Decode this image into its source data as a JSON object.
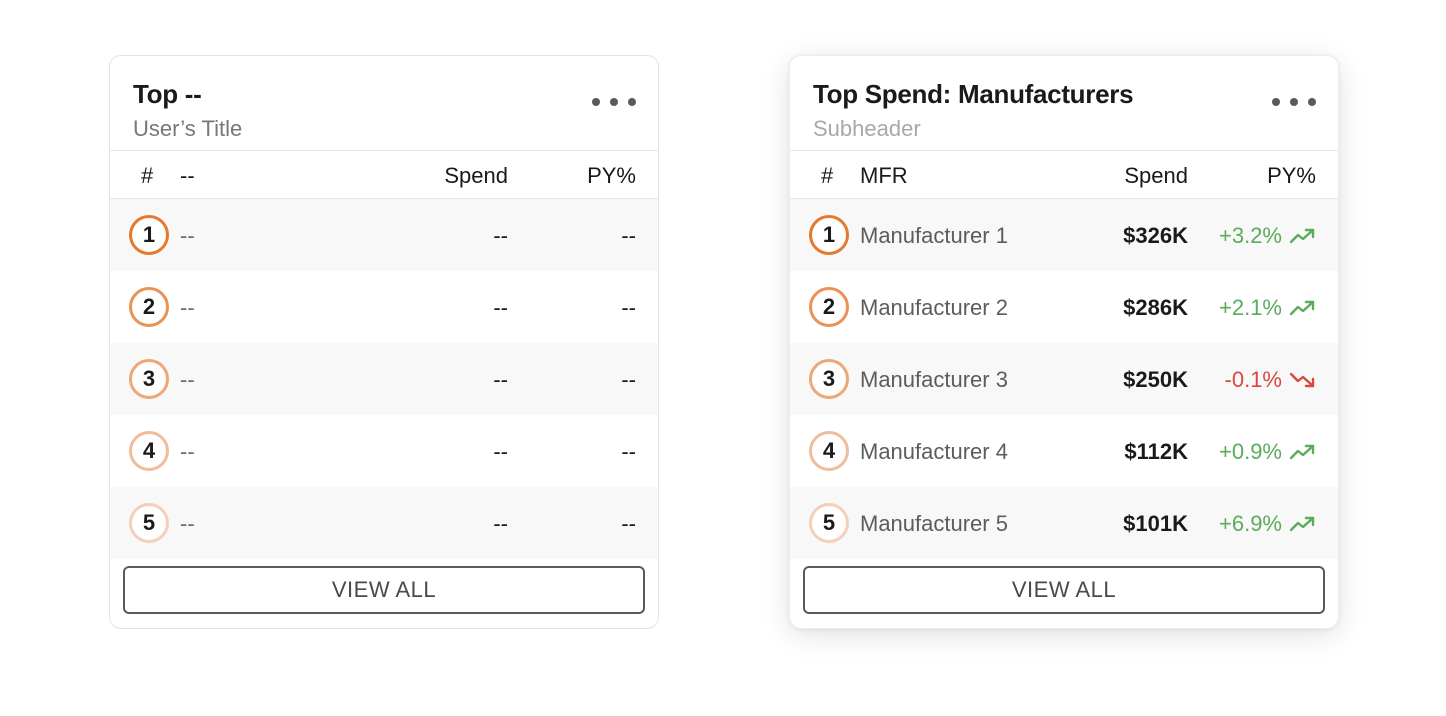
{
  "cards": [
    {
      "title": "Top --",
      "subtitle": "User’s Title",
      "columns": {
        "num": "#",
        "name": "--",
        "spend": "Spend",
        "py": "PY%"
      },
      "rows": [
        {
          "rank": "1",
          "name": "--",
          "spend": "--",
          "py": "--"
        },
        {
          "rank": "2",
          "name": "--",
          "spend": "--",
          "py": "--"
        },
        {
          "rank": "3",
          "name": "--",
          "spend": "--",
          "py": "--"
        },
        {
          "rank": "4",
          "name": "--",
          "spend": "--",
          "py": "--"
        },
        {
          "rank": "5",
          "name": "--",
          "spend": "--",
          "py": "--"
        }
      ],
      "view_all": "VIEW ALL"
    },
    {
      "title": "Top Spend: Manufacturers",
      "subtitle": "Subheader",
      "columns": {
        "num": "#",
        "name": "MFR",
        "spend": "Spend",
        "py": "PY%"
      },
      "rows": [
        {
          "rank": "1",
          "name": "Manufacturer 1",
          "spend": "$326K",
          "py": "+3.2%",
          "trend": "up",
          "trend_icon": "trending-up-icon"
        },
        {
          "rank": "2",
          "name": "Manufacturer 2",
          "spend": "$286K",
          "py": "+2.1%",
          "trend": "up",
          "trend_icon": "trending-up-icon"
        },
        {
          "rank": "3",
          "name": "Manufacturer 3",
          "spend": "$250K",
          "py": "-0.1%",
          "trend": "down",
          "trend_icon": "trending-down-icon"
        },
        {
          "rank": "4",
          "name": "Manufacturer 4",
          "spend": "$112K",
          "py": "+0.9%",
          "trend": "up",
          "trend_icon": "trending-up-icon"
        },
        {
          "rank": "5",
          "name": "Manufacturer 5",
          "spend": "$101K",
          "py": "+6.9%",
          "trend": "up",
          "trend_icon": "trending-up-icon"
        }
      ],
      "view_all": "VIEW ALL"
    }
  ],
  "colors": {
    "rank_ring": [
      "#e57a2c",
      "#ea9254",
      "#eea779",
      "#f2bc9b",
      "#f5cfb8"
    ],
    "positive": "#5aab5a",
    "negative": "#d9473f"
  }
}
